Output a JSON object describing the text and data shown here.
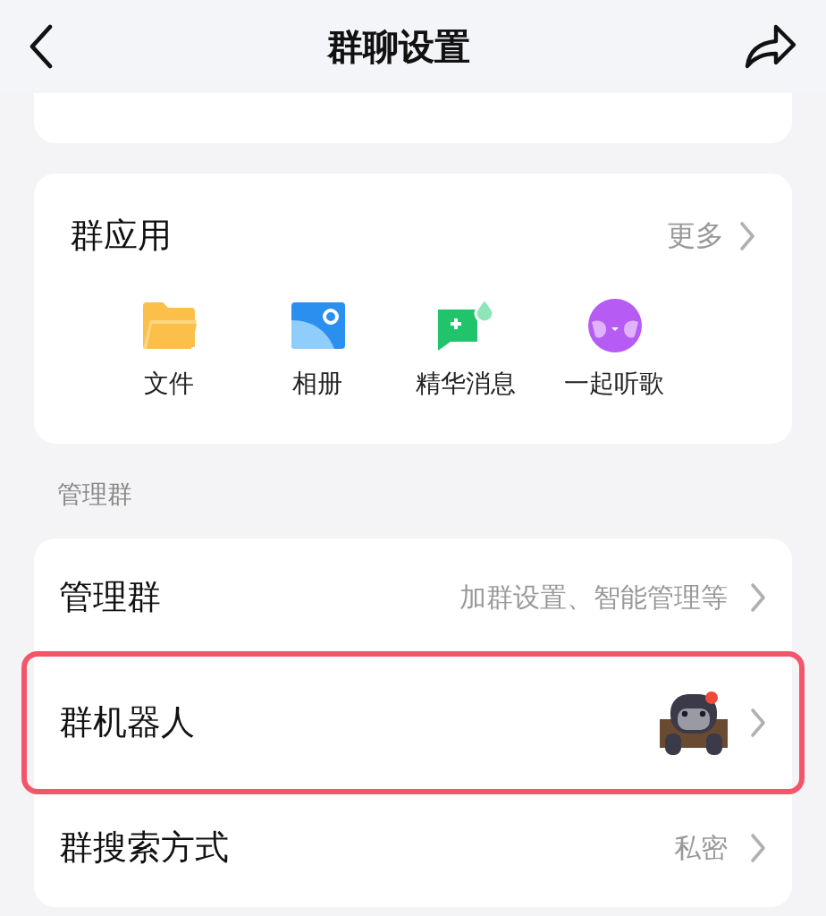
{
  "header": {
    "title": "群聊设置"
  },
  "apps_card": {
    "title": "群应用",
    "more": "更多",
    "apps": [
      {
        "kind": "folder",
        "label": "文件"
      },
      {
        "kind": "album",
        "label": "相册"
      },
      {
        "kind": "essence",
        "label": "精华消息"
      },
      {
        "kind": "music",
        "label": "一起听歌"
      }
    ]
  },
  "section_label": "管理群",
  "rows": [
    {
      "kind": "text",
      "label": "管理群",
      "value": "加群设置、智能管理等",
      "highlighted": false
    },
    {
      "kind": "avatar",
      "label": "群机器人",
      "highlighted": true
    },
    {
      "kind": "text",
      "label": "群搜索方式",
      "value": "私密",
      "highlighted": false
    }
  ]
}
